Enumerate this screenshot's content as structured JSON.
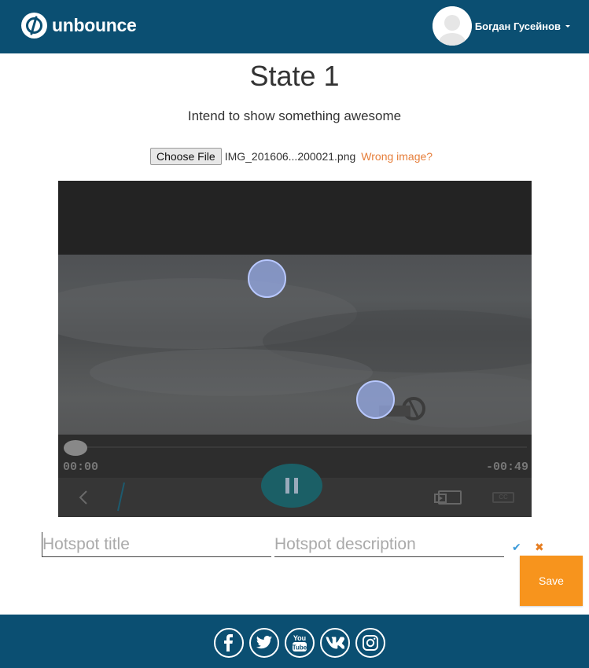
{
  "header": {
    "logo_text": "unbounce",
    "user_name": "Богдан Гусейнов",
    "background_color": "#0b4f72"
  },
  "main": {
    "title": "State 1",
    "subtitle": "Intend to show something awesome",
    "file": {
      "button_label": "Choose File",
      "file_name": "IMG_201606...200021.png",
      "wrong_link": "Wrong image?"
    },
    "video": {
      "time_elapsed": "00:00",
      "time_remaining": "-00:49",
      "cc_label": "CC"
    },
    "hotspot_form": {
      "title_placeholder": "Hotspot title",
      "description_placeholder": "Hotspot description",
      "save_label": "Save"
    }
  },
  "footer": {
    "socials": [
      "facebook-icon",
      "twitter-icon",
      "youtube-icon",
      "vk-icon",
      "instagram-icon"
    ]
  },
  "colors": {
    "brand_blue": "#0b4f72",
    "accent_orange": "#f7941d",
    "link_orange": "#e67e3a",
    "confirm_blue": "#3a9ad9"
  }
}
